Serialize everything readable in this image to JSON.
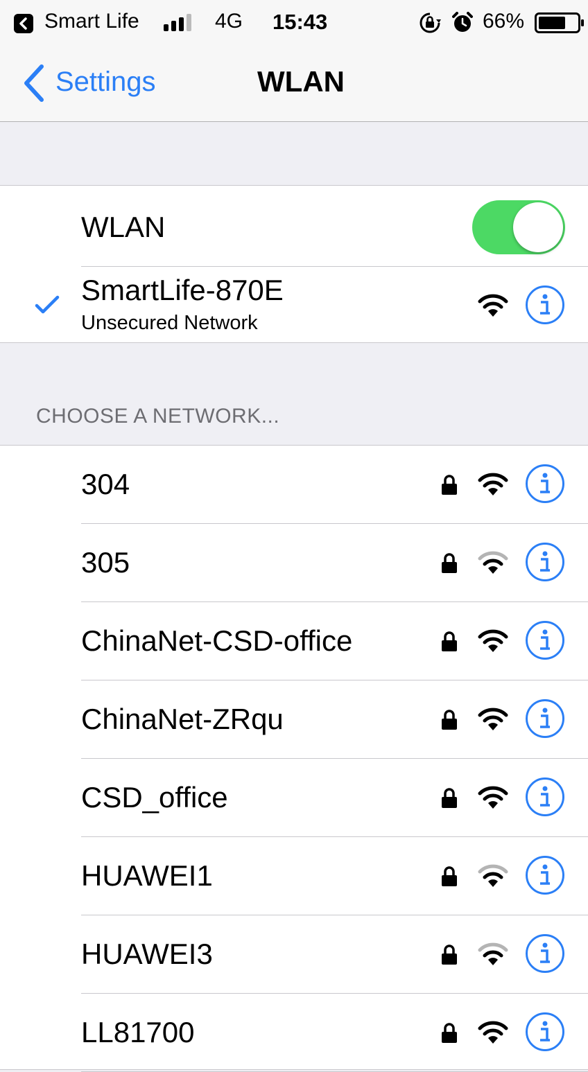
{
  "status_bar": {
    "carrier": "Smart Life",
    "network_type": "4G",
    "time": "15:43",
    "battery_percent": "66%",
    "icons": [
      "back-app-icon",
      "signal-icon",
      "rotation-lock-icon",
      "alarm-icon",
      "battery-icon"
    ]
  },
  "nav": {
    "back_label": "Settings",
    "title": "WLAN"
  },
  "wlan": {
    "toggle_label": "WLAN",
    "toggle_on": true,
    "connected": {
      "name": "SmartLife-870E",
      "subtitle": "Unsecured Network",
      "signal": "strong"
    }
  },
  "choose": {
    "header": "CHOOSE A NETWORK...",
    "networks": [
      {
        "name": "304",
        "secured": true,
        "signal": "strong"
      },
      {
        "name": "305",
        "secured": true,
        "signal": "weak"
      },
      {
        "name": "ChinaNet-CSD-office",
        "secured": true,
        "signal": "strong"
      },
      {
        "name": "ChinaNet-ZRqu",
        "secured": true,
        "signal": "strong"
      },
      {
        "name": "CSD_office",
        "secured": true,
        "signal": "strong"
      },
      {
        "name": "HUAWEI1",
        "secured": true,
        "signal": "weak"
      },
      {
        "name": "HUAWEI3",
        "secured": true,
        "signal": "weak"
      },
      {
        "name": "LL81700",
        "secured": true,
        "signal": "strong"
      }
    ]
  },
  "colors": {
    "accent": "#2b7ff6",
    "toggle_on": "#4cd964",
    "background": "#efeff4"
  }
}
